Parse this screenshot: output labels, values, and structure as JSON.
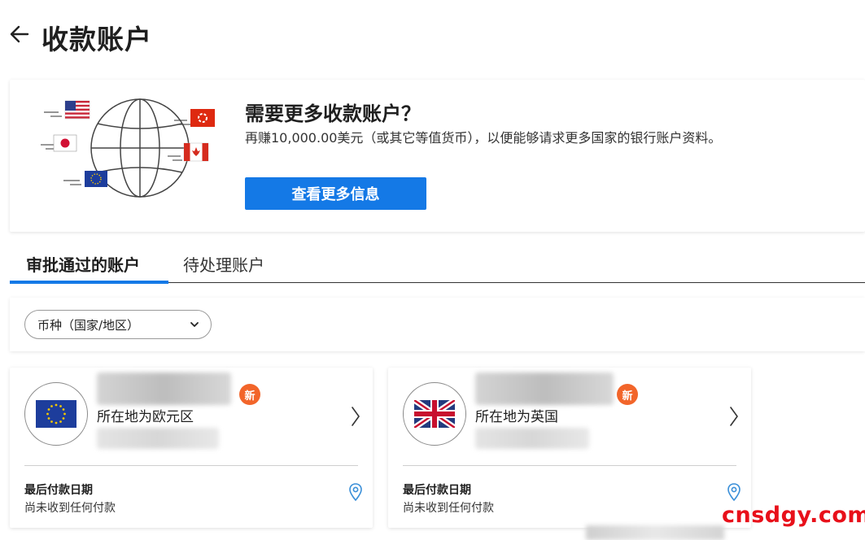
{
  "page": {
    "title": "收款账户"
  },
  "promo": {
    "title": "需要更多收款账户？",
    "description": "再赚10,000.00美元（或其它等值货币），以便能够请求更多国家的银行账户资料。",
    "button_label": "查看更多信息"
  },
  "tabs": [
    {
      "label": "审批通过的账户",
      "active": true
    },
    {
      "label": "待处理账户",
      "active": false
    }
  ],
  "filter": {
    "label": "币种（国家/地区）"
  },
  "accounts": [
    {
      "flag": "eu-flag-icon",
      "badge": "新",
      "location": "所在地为欧元区",
      "last_payment_label": "最后付款日期",
      "last_payment_value": "尚未收到任何付款"
    },
    {
      "flag": "uk-flag-icon",
      "badge": "新",
      "location": "所在地为英国",
      "last_payment_label": "最后付款日期",
      "last_payment_value": "尚未收到任何付款"
    }
  ],
  "watermark": "cnsdgy.com",
  "colors": {
    "accent": "#1479e6",
    "badge": "#f2652a",
    "watermark": "#e8101a"
  }
}
